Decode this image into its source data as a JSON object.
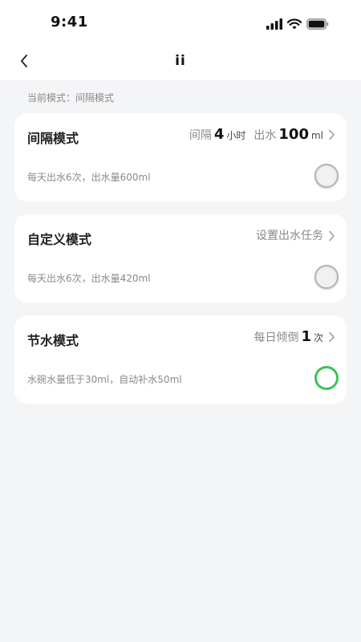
{
  "status_bar": {
    "time": "9:41"
  },
  "nav": {
    "title": "ii"
  },
  "current_mode_text": "当前模式：间隔模式",
  "cards": [
    {
      "title": "间隔模式",
      "right": {
        "interval_label": "间隔",
        "interval_value": "4",
        "interval_unit": "小时",
        "water_label": "出水",
        "water_value": "100",
        "water_unit": "ml"
      },
      "description": "每天出水6次，出水量600ml",
      "selected": false
    },
    {
      "title": "自定义模式",
      "right": {
        "text": "设置出水任务"
      },
      "description": "每天出水6次，出水量420ml",
      "selected": false
    },
    {
      "title": "节水模式",
      "right": {
        "label": "每日倾倒",
        "value": "1",
        "unit": "次"
      },
      "description": "水碗水量低于30ml，自动补水50ml",
      "selected": true
    }
  ],
  "colors": {
    "accent_green": "#3cc25a",
    "background": "#f4f5f7",
    "card": "#ffffff",
    "muted_text": "#8a8a8a"
  }
}
